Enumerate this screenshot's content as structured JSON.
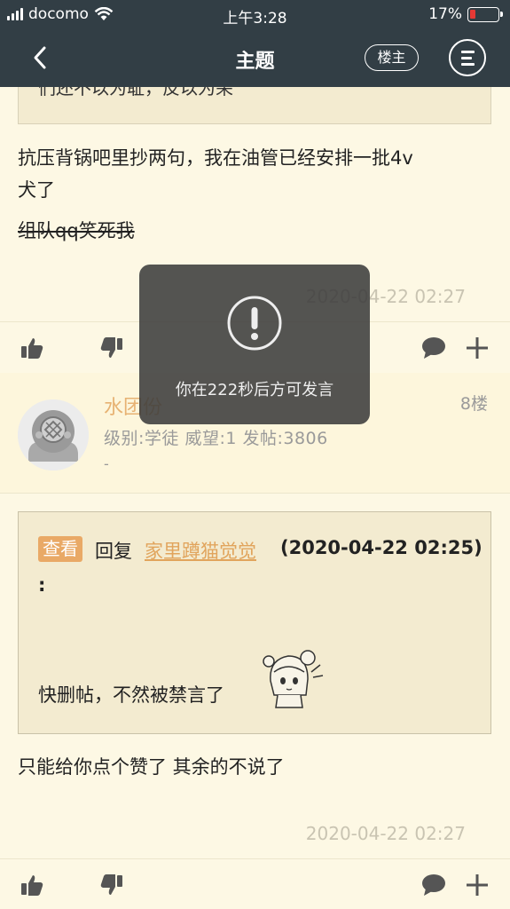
{
  "status_bar": {
    "carrier": "docomo",
    "time": "上午3:28",
    "battery": "17%",
    "battery_level": 0.17
  },
  "nav": {
    "title": "主题",
    "owner_button": "楼主"
  },
  "post_7": {
    "quote_fragment": "们还不以为耻，反以为荣",
    "text_line1": "抗压背锅吧里抄两句，我在油管已经安排一批4v",
    "text_line2": "犬了",
    "text_line3": "组队qq笑死我",
    "timestamp": "2020-04-22 02:27"
  },
  "post_8": {
    "username": "水团份",
    "floor": "8楼",
    "meta": "级别:学徒  威望:1  发帖:3806",
    "signature": "-",
    "quote": {
      "view_tag": "查看",
      "reply_word": "回复",
      "reply_user": "家里蹲猫觉觉",
      "reply_time": "(2020-04-22 02:25)",
      "colon": ":",
      "body": "快删帖，不然被禁言了"
    },
    "text": "只能给你点个赞了 其余的不说了",
    "timestamp": "2020-04-22 02:27"
  },
  "toast": {
    "message": "你在222秒后方可发言"
  },
  "colors": {
    "nav_bg": "#323e45",
    "page_bg": "#fdf8e4",
    "accent": "#e9a966",
    "battery_low": "#e53935"
  }
}
